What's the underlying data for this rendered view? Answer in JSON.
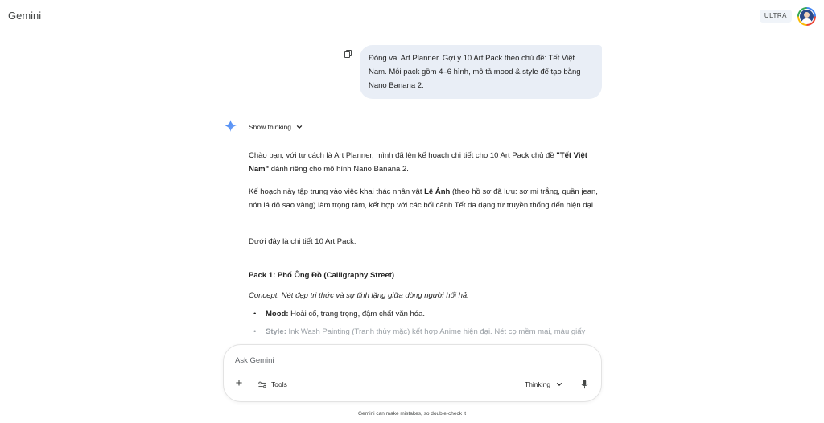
{
  "app": {
    "title": "Gemini",
    "plan_badge": "ULTRA"
  },
  "user_message": {
    "lines": [
      "Đóng vai Art Planner. Gợi ý 10 Art Pack theo chủ đề: Tết Việt",
      "Nam. Mỗi pack gồm 4–6 hình, mô tả mood & style để tạo bằng",
      "Nano Banana 2."
    ]
  },
  "response": {
    "show_thinking": "Show thinking",
    "p1": {
      "text_a": "Chào bạn, với tư cách là Art Planner, mình đã lên kế hoạch chi tiết cho 10 Art Pack chủ đề ",
      "bold": "\"Tết Việt Nam\"",
      "text_b": " dành riêng cho mô hình Nano Banana 2."
    },
    "p2": {
      "text_a": "Kế hoạch này tập trung vào việc khai thác nhân vật ",
      "bold": "Lê Ánh",
      "text_b": " (theo hồ sơ đã lưu: sơ mi trắng, quần jean, nón lá đỏ sao vàng) làm trọng tâm, kết hợp với các bối cảnh Tết đa dạng từ truyền thống đến hiện đại."
    },
    "p3": "Dưới đây là chi tiết 10 Art Pack:",
    "pack1": {
      "title": "Pack 1: Phố Ông Đồ (Calligraphy Street)",
      "concept": "Concept: Nét đẹp tri thức và sự tĩnh lặng giữa dòng người hối hả.",
      "mood_label": "Mood:",
      "mood_text": " Hoài cổ, trang trọng, đậm chất văn hóa.",
      "style_label": "Style:",
      "style_text": " Ink Wash Painting (Tranh thủy mặc) kết hợp Anime hiện đại. Nét cọ mềm mại, màu giấy"
    }
  },
  "composer": {
    "placeholder": "Ask Gemini",
    "tools_label": "Tools",
    "mode_label": "Thinking"
  },
  "footer": "Gemini can make mistakes, so double-check it",
  "colors": {
    "accent": "#4285f4",
    "bubble": "#e9eef6",
    "text": "#1f1f1f"
  },
  "icons": [
    "copy-icon",
    "gemini-sparkle-icon",
    "chevron-down-icon",
    "plus-icon",
    "tools-icon",
    "microphone-icon"
  ]
}
